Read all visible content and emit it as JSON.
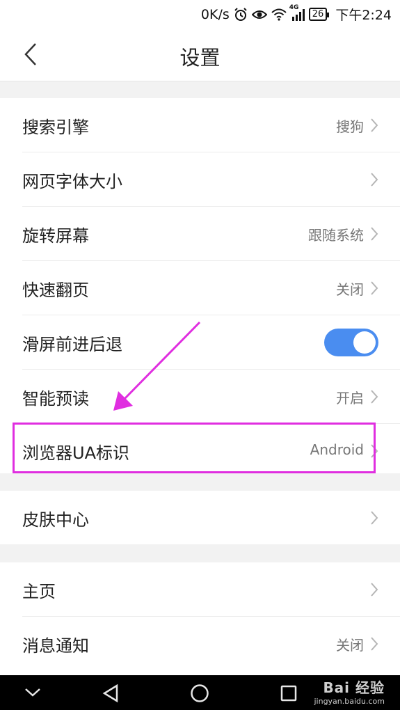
{
  "status_bar": {
    "network_speed": "0K/s",
    "network_type": "4G",
    "battery": "26",
    "time": "下午2:24",
    "icons": [
      "alarm-icon",
      "eye-icon",
      "wifi-icon",
      "signal-icon",
      "battery-icon"
    ]
  },
  "header": {
    "title": "设置",
    "back_icon": "back-arrow-icon"
  },
  "groups": [
    {
      "items": [
        {
          "label": "搜索引擎",
          "value": "搜狗",
          "type": "link"
        },
        {
          "label": "网页字体大小",
          "value": "",
          "type": "link"
        },
        {
          "label": "旋转屏幕",
          "value": "跟随系统",
          "type": "link"
        },
        {
          "label": "快速翻页",
          "value": "关闭",
          "type": "link"
        },
        {
          "label": "滑屏前进后退",
          "value": "",
          "type": "toggle",
          "on": true
        },
        {
          "label": "智能预读",
          "value": "开启",
          "type": "link"
        },
        {
          "label": "浏览器UA标识",
          "value": "Android",
          "type": "link",
          "highlighted": true
        }
      ]
    },
    {
      "items": [
        {
          "label": "皮肤中心",
          "value": "",
          "type": "link"
        }
      ]
    },
    {
      "items": [
        {
          "label": "主页",
          "value": "",
          "type": "link"
        },
        {
          "label": "消息通知",
          "value": "关闭",
          "type": "link"
        }
      ]
    }
  ],
  "colors": {
    "toggle_on": "#4a8df0",
    "annotation": "#e02ee0",
    "background": "#f2f2f2"
  },
  "nav_bar": {
    "buttons": [
      "collapse-icon",
      "back-triangle-icon",
      "home-circle-icon",
      "recents-square-icon"
    ]
  },
  "watermark": {
    "logo": "Bai 经验",
    "url": "jingyan.baidu.com"
  }
}
